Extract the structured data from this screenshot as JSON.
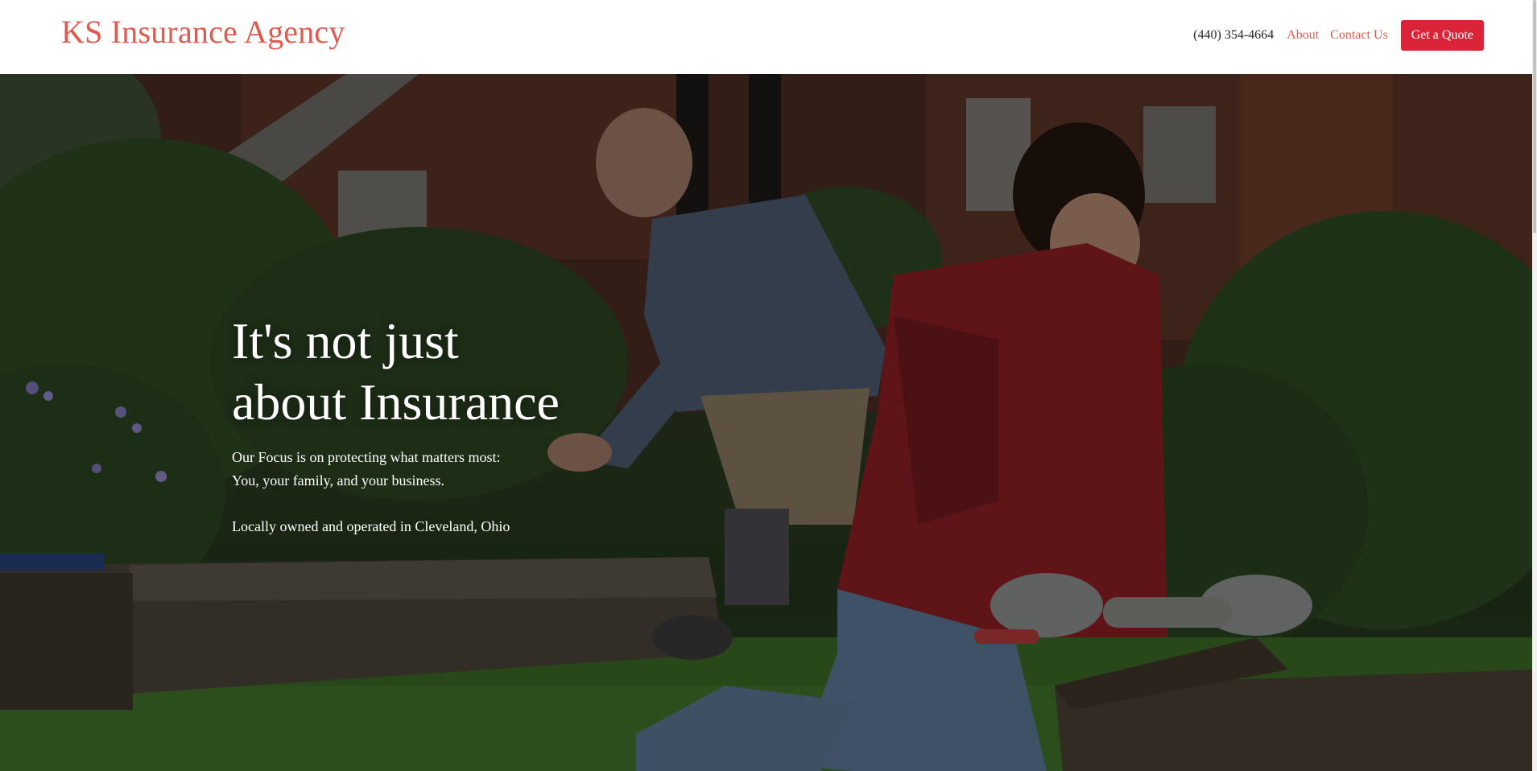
{
  "header": {
    "brand": "KS Insurance Agency",
    "phone": "(440) 354-4664",
    "nav": [
      {
        "label": "About"
      },
      {
        "label": "Contact Us"
      }
    ],
    "cta_label": "Get a Quote"
  },
  "hero": {
    "title_line1": "It's not just",
    "title_line2": "about Insurance",
    "sub_line1": "Our Focus is on protecting what matters most:",
    "sub_line2": "You, your family, and your business.",
    "local": "Locally owned and operated in Cleveland, Ohio",
    "image_icon": "garden-photo"
  },
  "colors": {
    "brand": "#e05a4f",
    "accent": "#dc2438",
    "text_dark": "#222222",
    "hero_text": "#ffffff"
  }
}
